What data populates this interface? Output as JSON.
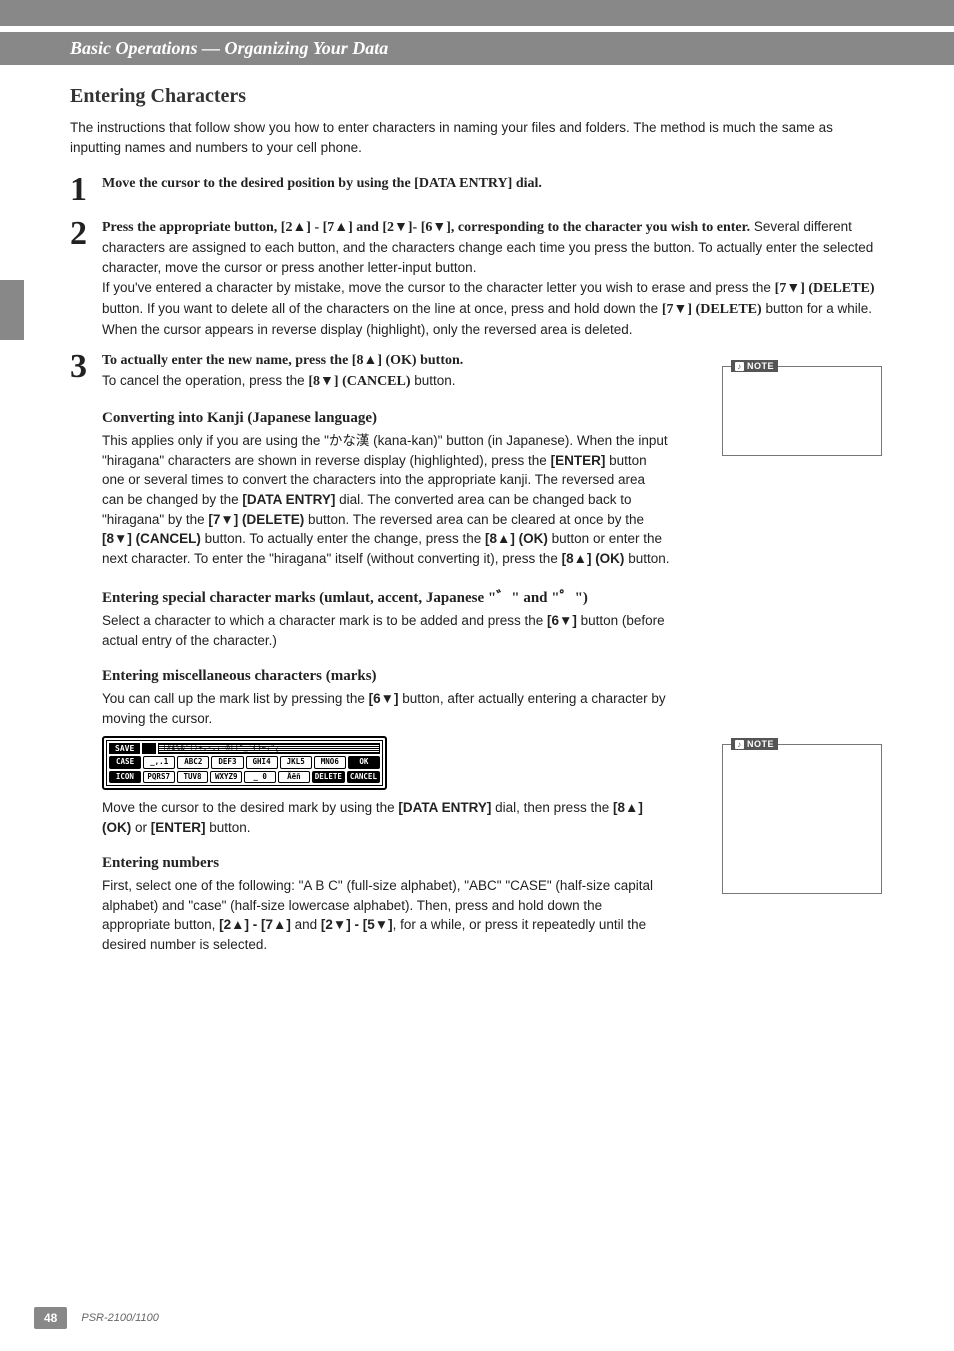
{
  "header": {
    "section": "Basic Operations — Organizing Your Data"
  },
  "title": "Entering Characters",
  "intro": "The instructions that follow show you how to enter characters in naming your files and folders. The method is much the same as inputting names and numbers to your cell phone.",
  "step1": {
    "num": "1",
    "bold": "Move the cursor to the desired position by using the ",
    "btn": "[DATA ENTRY]",
    "bold_tail": " dial."
  },
  "step2": {
    "num": "2",
    "lead_a": "Press the appropriate button, ",
    "btn_range1": "[2▲] - [7▲] and [2▼]- [6▼]",
    "lead_b": ", corresponding to the character you wish to enter.",
    "line2": "Several different characters are assigned to each button, and the characters change each time you press the button. To actually enter the selected character, move the cursor or press another letter-input button.",
    "line3": "If you've entered a character by mistake, move the cursor to the character letter you wish to erase and press the ",
    "btn7d": "[7▼] (DELETE)",
    "line3b": " button. If you want to delete all of the characters on the line at once, press and hold down the ",
    "btn7d2": "[7▼] (DELETE)",
    "line3c": " button for a while. When the cursor appears in reverse display (highlight), only the reversed area is deleted."
  },
  "step3": {
    "num": "3",
    "bold": "To actually enter the new name, press the ",
    "btn": "[8▲] (OK)",
    "bold_tail": " button.",
    "line2a": "To cancel the operation, press the ",
    "btn_cancel": "[8▼] (CANCEL)",
    "line2b": " button."
  },
  "kanji": {
    "head": "Converting into Kanji (Japanese language)",
    "p1a": "This applies only if you are using the \"",
    "kana": "かな漢",
    "p1b": " (kana-kan)\" button (in Japanese). When the input \"hiragana\" characters are shown in reverse display (highlighted), press the ",
    "enter_btn": "[ENTER]",
    "p1c": " button one or several times to convert the characters into the appropriate kanji. The reversed area can be changed by the ",
    "de_btn": "[DATA ENTRY]",
    "p1d": " dial. The converted area can be changed back to \"hiragana\" by the ",
    "del_btn": "[7▼] (DELETE)",
    "p1e": " button. The reversed area can be cleared at once by the ",
    "cancel_btn": "[8▼] (CANCEL)",
    "p1f": " button. To actually enter the change, press the ",
    "ok_btn": "[8▲] (OK)",
    "p1g": " button or enter the next character. To enter the \"hiragana\" itself (without converting it), press the ",
    "ok_btn2": "[8▲] (OK)",
    "p1h": " button."
  },
  "special": {
    "head": "Entering special character marks (umlaut, accent, Japanese \"゛\" and \"゜\")",
    "p1a": "Select a character to which a character mark is to be added and press the ",
    "btn": "[6▼]",
    "p1b": " button (before actual entry of the character.)"
  },
  "misc": {
    "head": "Entering miscellaneous characters (marks)",
    "p1a": "You can call up the mark list by pressing the ",
    "btn": "[6▼]",
    "p1b": " button, after actually entering a character by moving the cursor.",
    "p2a": "Move the cursor to the desired mark by using the ",
    "de_btn": "[DATA ENTRY]",
    "p2b": " dial, then press the ",
    "ok_btn": "[8▲] (OK)",
    "p2c": " or ",
    "enter_btn": "[ENTER]",
    "p2d": " button."
  },
  "screen": {
    "save": "SAVE",
    "marks": "!#$%&'()+,-.;=@[]^_`{}~¡°¿",
    "row1": [
      "CASE",
      "_,.1",
      "ABC2",
      "DEF3",
      "GHI4",
      "JKL5",
      "MNO6",
      "OK"
    ],
    "row2": [
      "ICON",
      "PQRS7",
      "TUV8",
      "WXYZ9",
      "_ 0",
      "Äëñ",
      "DELETE",
      "CANCEL"
    ]
  },
  "numbers": {
    "head": "Entering numbers",
    "p1a": "First, select one of the following: \"A B C\" (full-size alphabet), \"ABC\" \"CASE\" (half-size capital alphabet) and \"case\" (half-size lowercase alphabet). Then, press and hold down the appropriate button, ",
    "btns1": "[2▲] - [7▲]",
    "p1b": " and ",
    "btns2": "[2▼] - [5▼]",
    "p1c": ", for a while, or press it repeatedly until the desired number is selected."
  },
  "notes": {
    "label": "NOTE"
  },
  "footer": {
    "page": "48",
    "manual": "PSR-2100/1100"
  }
}
